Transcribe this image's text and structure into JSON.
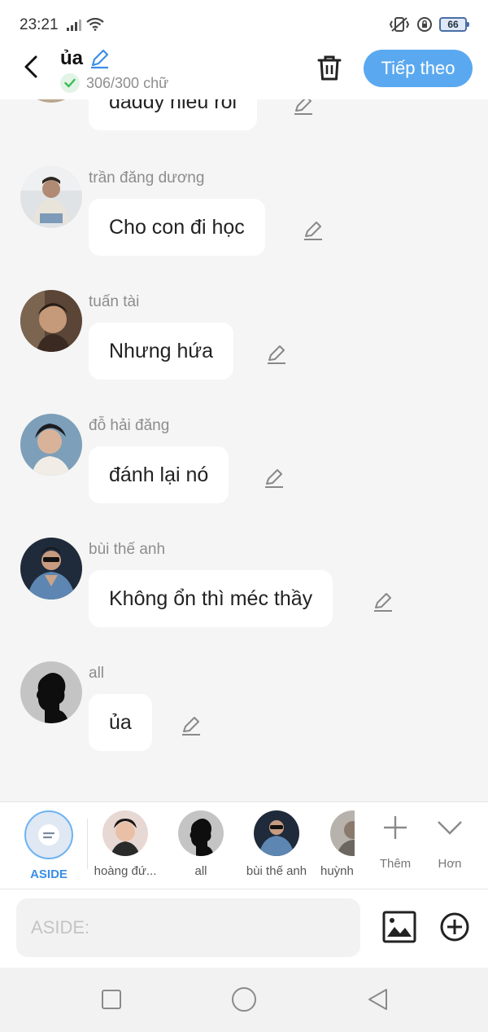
{
  "status_bar": {
    "time": "23:21",
    "battery": "66"
  },
  "header": {
    "title": "ủa",
    "char_counter": "306/300 chữ",
    "next_label": "Tiếp theo"
  },
  "messages": [
    {
      "sender": "",
      "text": "daddy hiểu rồi"
    },
    {
      "sender": "trần đăng dương",
      "text": "Cho con đi học"
    },
    {
      "sender": "tuấn tài",
      "text": "Nhưng hứa"
    },
    {
      "sender": "đỗ hải đăng",
      "text": "đánh lại nó"
    },
    {
      "sender": "bùi thế anh",
      "text": "Không ổn thì méc thầy"
    },
    {
      "sender": "all",
      "text": "ủa"
    }
  ],
  "roles": [
    {
      "label": "ASIDE",
      "icon": "aside-icon"
    },
    {
      "label": "hoàng đứ..."
    },
    {
      "label": "all"
    },
    {
      "label": "bùi thế anh"
    },
    {
      "label": "huỳnh"
    }
  ],
  "role_actions": {
    "add_label": "Thêm",
    "more_label": "Hơn"
  },
  "input": {
    "placeholder": "ASIDE:"
  },
  "colors": {
    "accent": "#5aa9f0",
    "aside_label": "#3a8ee6",
    "check": "#3dbb55"
  }
}
